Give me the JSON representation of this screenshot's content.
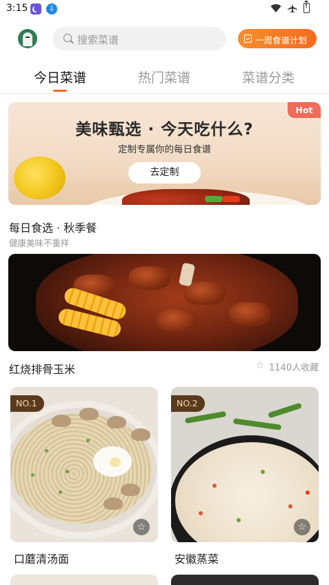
{
  "status_bar": {
    "time": "3:15",
    "download_glyph": "⇩"
  },
  "header": {
    "search_placeholder": "搜索菜谱",
    "plan_button": "一周食谱计划"
  },
  "tabs": [
    {
      "label": "今日菜谱",
      "active": true
    },
    {
      "label": "热门菜谱",
      "active": false
    },
    {
      "label": "菜谱分类",
      "active": false
    }
  ],
  "banner": {
    "title": "美味甄选 · 今天吃什么?",
    "subtitle": "定制专属你的每日食谱",
    "button": "去定制",
    "badge": "Hot"
  },
  "section": {
    "title": "每日食选 · 秋季餐",
    "subtitle": "健康美味不重样"
  },
  "featured": {
    "name": "红烧排骨玉米",
    "favorites": "1140人收藏"
  },
  "cards": [
    {
      "rank": "NO.1",
      "title": "口蘑清汤面"
    },
    {
      "rank": "NO.2",
      "title": "安徽蒸菜"
    }
  ],
  "icons": {
    "star": "☆"
  },
  "colors": {
    "accent": "#f36b1e",
    "hot": "#f26a5a",
    "rank_bg": "#5a3a1e"
  }
}
